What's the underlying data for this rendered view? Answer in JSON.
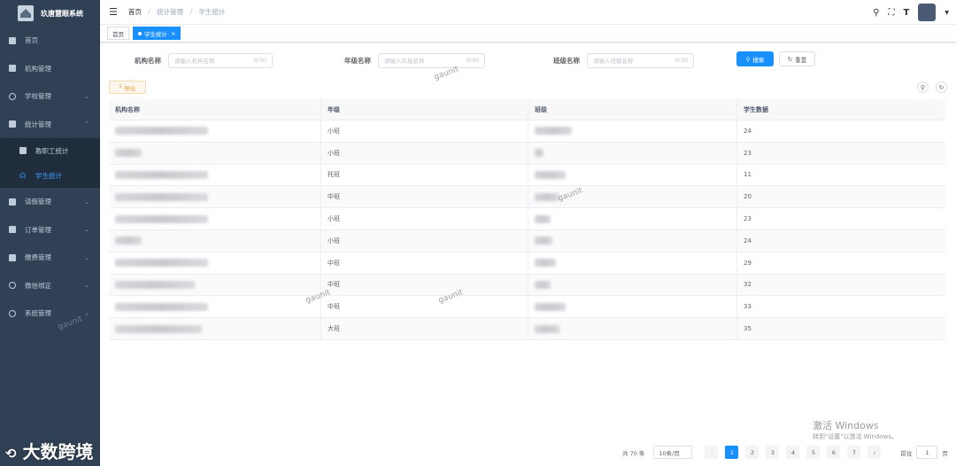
{
  "app": {
    "title": "玖唐慧眼系统"
  },
  "sidebar": {
    "items": [
      {
        "label": "首页"
      },
      {
        "label": "机构管理"
      },
      {
        "label": "学校管理"
      },
      {
        "label": "统计管理"
      },
      {
        "label": "教职工统计"
      },
      {
        "label": "学生统计"
      },
      {
        "label": "请假管理"
      },
      {
        "label": "订单管理"
      },
      {
        "label": "缴费管理"
      },
      {
        "label": "微信绑定"
      },
      {
        "label": "系统管理"
      }
    ]
  },
  "breadcrumb": {
    "home": "首页",
    "level1": "统计管理",
    "current": "学生统计"
  },
  "tags": {
    "home": "首页",
    "current": "学生统计"
  },
  "filters": {
    "org": {
      "label": "机构名称",
      "placeholder": "请输入机构名称",
      "count": "0/30"
    },
    "grade": {
      "label": "年级名称",
      "placeholder": "请输入年级名称",
      "count": "0/30"
    },
    "class": {
      "label": "班级名称",
      "placeholder": "请输入班级名称",
      "count": "0/30"
    }
  },
  "buttons": {
    "search": "搜索",
    "reset": "重置",
    "export": "导出"
  },
  "table": {
    "headers": [
      "机构名称",
      "年级",
      "班级",
      "学生数据"
    ],
    "rows": [
      {
        "grade": "小班",
        "count": "24"
      },
      {
        "grade": "小班",
        "count": "23"
      },
      {
        "grade": "托班",
        "count": "11"
      },
      {
        "grade": "中班",
        "count": "20"
      },
      {
        "grade": "小班",
        "count": "23"
      },
      {
        "grade": "小班",
        "count": "24"
      },
      {
        "grade": "中班",
        "count": "29"
      },
      {
        "grade": "中班",
        "count": "32"
      },
      {
        "grade": "中班",
        "count": "33"
      },
      {
        "grade": "大班",
        "count": "35"
      }
    ]
  },
  "pagination": {
    "total": "共 70 条",
    "page_size": "10条/页",
    "pages": [
      "1",
      "2",
      "3",
      "4",
      "5",
      "6",
      "7"
    ],
    "goto_label": "前往",
    "goto_value": "1",
    "page_suffix": "页"
  },
  "watermark": {
    "text": "gaunit"
  },
  "os_overlay": {
    "activate_title": "激活 Windows",
    "activate_sub": "转到\"设置\"以激活 Windows。"
  },
  "corner_brand": {
    "text": "大数跨境"
  }
}
